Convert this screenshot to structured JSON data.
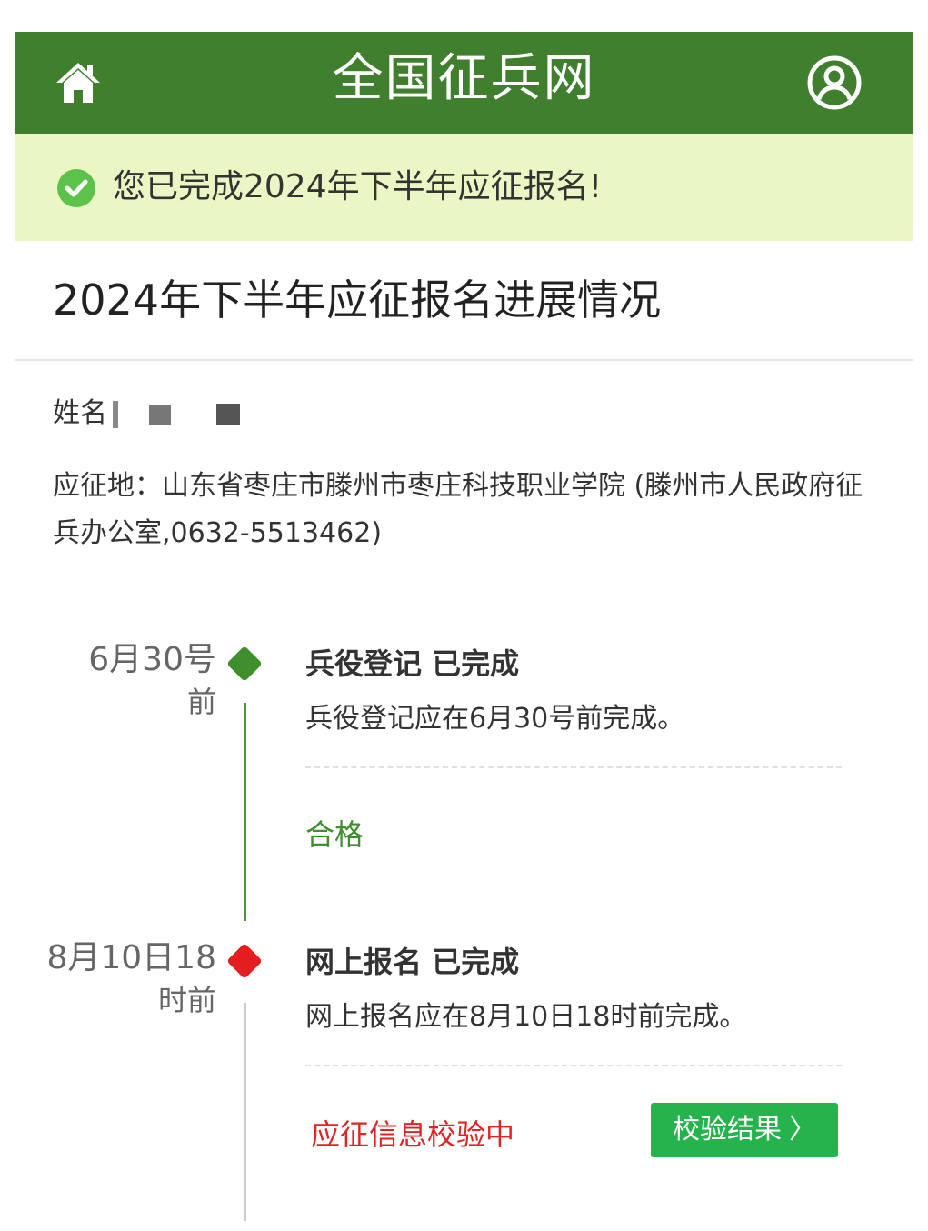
{
  "header": {
    "title": "全国征兵网",
    "home_icon": "home-icon",
    "user_icon": "user-icon"
  },
  "banner": {
    "icon": "check-circle-icon",
    "message": "您已完成2024年下半年应征报名!"
  },
  "section": {
    "title": "2024年下半年应征报名进展情况"
  },
  "info": {
    "name_label": "姓名",
    "address": "应征地：山东省枣庄市滕州市枣庄科技职业学院 (滕州市人民政府征兵办公室,0632-5513462)"
  },
  "timeline": [
    {
      "date": "6月30号",
      "date_sub": "前",
      "title": "兵役登记 已完成",
      "desc": "兵役登记应在6月30号前完成。",
      "status": "合格",
      "marker_color": "#3f8f2e"
    },
    {
      "date": "8月10日18",
      "date_sub": "时前",
      "title": "网上报名 已完成",
      "desc": "网上报名应在8月10日18时前完成。",
      "status": "应征信息校验中",
      "marker_color": "#e41e1e",
      "button_label": "校验结果",
      "button_chevron": "〉"
    }
  ],
  "colors": {
    "header_bg": "#3f7f2e",
    "banner_bg": "#eaf7c4",
    "success_green": "#3f8f2e",
    "alert_red": "#e02424",
    "button_green": "#25b34b"
  }
}
